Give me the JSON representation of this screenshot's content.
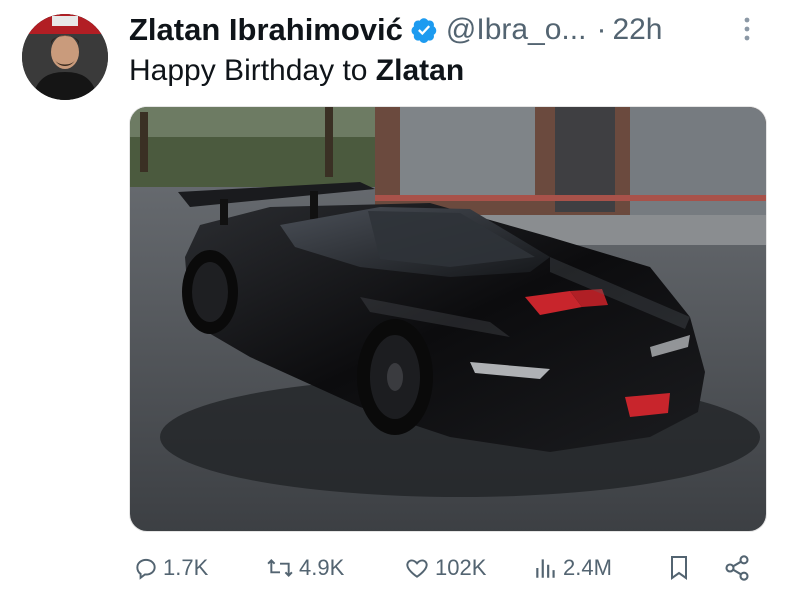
{
  "tweet": {
    "author_name": "Zlatan Ibrahimović",
    "handle": "@Ibra_o...",
    "separator": "·",
    "time": "22h",
    "text_prefix": "Happy Birthday to ",
    "text_bold": "Zlatan",
    "verified_color": "#1d9bf0",
    "avatar_icon": "profile-photo",
    "more_icon": "more-vertical-icon"
  },
  "media": {
    "subject": "black Ferrari SF90 supercar photo",
    "accent_color": "#d0202a"
  },
  "actions": {
    "replies": "1.7K",
    "reposts": "4.9K",
    "likes": "102K",
    "views": "2.4M",
    "reply_icon": "reply-icon",
    "repost_icon": "repost-icon",
    "like_icon": "heart-icon",
    "views_icon": "views-icon",
    "bookmark_icon": "bookmark-icon",
    "share_icon": "share-icon"
  }
}
